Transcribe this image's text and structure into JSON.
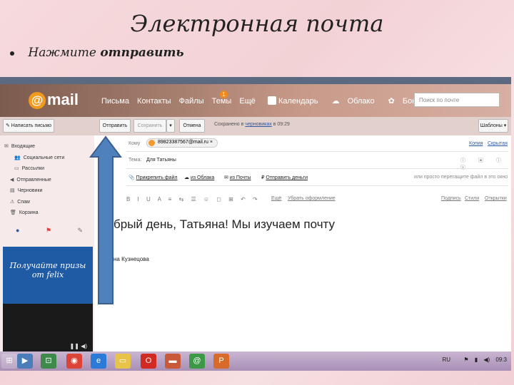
{
  "slide": {
    "title": "Электронная почта",
    "bullet_prefix": "Нажмите",
    "bullet_emphasis": "отправить"
  },
  "header": {
    "logo": "mail",
    "nav": [
      "Письма",
      "Контакты",
      "Файлы",
      "Темы",
      "Ещё"
    ],
    "badge": "1",
    "services": [
      "Календарь",
      "Облако",
      "Бонус"
    ],
    "search_placeholder": "Поиск по почте"
  },
  "toolbar": {
    "compose": "Написать письмо",
    "send": "Отправить",
    "save": "Сохранить",
    "cancel": "Отмена",
    "saved_prefix": "Сохранено в",
    "saved_link": "черновиках",
    "saved_time": "в 09:29",
    "templates": "Шаблоны"
  },
  "sidebar": {
    "folders": [
      {
        "icon": "inbox-icon",
        "glyph": "✉",
        "label": "Входящие"
      },
      {
        "icon": "people-icon",
        "glyph": "👥",
        "label": "Социальные сети"
      },
      {
        "icon": "newsletter-icon",
        "glyph": "▭",
        "label": "Рассылки"
      },
      {
        "icon": "sent-icon",
        "glyph": "◀",
        "label": "Отправленные"
      },
      {
        "icon": "draft-icon",
        "glyph": "▤",
        "label": "Черновики"
      },
      {
        "icon": "spam-icon",
        "glyph": "⚠",
        "label": "Спам"
      },
      {
        "icon": "trash-icon",
        "glyph": "🗑",
        "label": "Корзина"
      }
    ],
    "ad_line1": "Получайте призы",
    "ad_line2": "от felix"
  },
  "compose": {
    "to_label": "Кому",
    "recipient": "89823387567@mail.ru",
    "copy": "Копия",
    "hidden": "Скрытая",
    "subject_label": "Тема:",
    "subject": "Для Татьяны",
    "attach_file": "Прикрепить файл",
    "from_cloud": "из Облака",
    "from_mail": "из Почты",
    "send_money": "Отправить деньги",
    "drag_hint": "или просто перетащите файл в это окно",
    "more": "Ещё",
    "remove_format": "Убрать оформление",
    "signature_link": "Подпись",
    "styles": "Стили",
    "postcards": "Открытки",
    "body": "брый день, Татьяна! Мы изучаем почту",
    "signature": "на Кузнецова"
  },
  "taskbar": {
    "lang": "RU",
    "time": "09:3"
  },
  "colors": {
    "accent": "#f29a1e",
    "arrow": "#4f81bd",
    "arrow_border": "#3a5f8e",
    "link": "#2a5aa8"
  }
}
